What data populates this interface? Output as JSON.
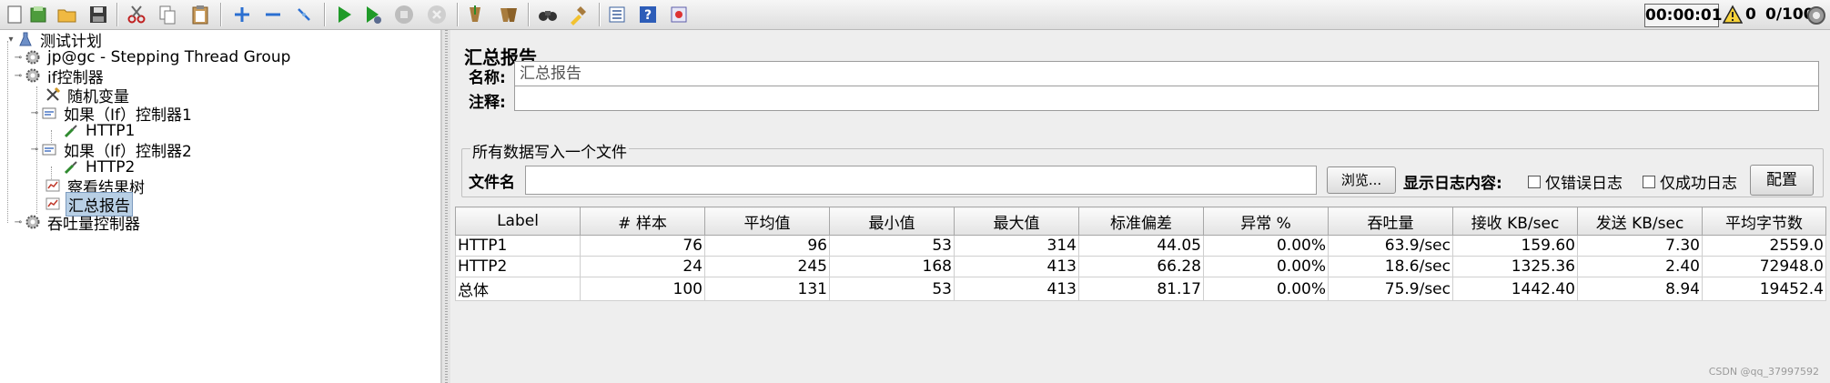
{
  "toolbar": {
    "buttons": [
      "new-icon",
      "templates-icon",
      "open-icon",
      "save-icon",
      "cut-icon",
      "copy-icon",
      "paste-icon",
      "expand-icon",
      "collapse-icon",
      "toggle-icon",
      "start-icon",
      "start-no-pause-icon",
      "stop-icon",
      "shutdown-icon",
      "clear-icon",
      "clear-all-icon",
      "search-icon",
      "reset-search-icon",
      "function-helper-icon",
      "help-icon",
      "remote-icon"
    ],
    "timer": "00:00:01",
    "error_count": "0",
    "threads": "0/100"
  },
  "tree": {
    "nodes": [
      {
        "label": "测试计划",
        "icon": "flask-icon"
      },
      {
        "label": "jp@gc - Stepping Thread Group",
        "icon": "gear-icon"
      },
      {
        "label": "if控制器",
        "icon": "gear-icon"
      },
      {
        "label": "随机变量",
        "icon": "tools-icon"
      },
      {
        "label": "如果（If）控制器1",
        "icon": "if-controller-icon"
      },
      {
        "label": "HTTP1",
        "icon": "pipette-icon"
      },
      {
        "label": "如果（If）控制器2",
        "icon": "if-controller-icon"
      },
      {
        "label": "HTTP2",
        "icon": "pipette-icon"
      },
      {
        "label": "察看结果树",
        "icon": "chart-icon"
      },
      {
        "label": "汇总报告",
        "icon": "chart-icon"
      },
      {
        "label": "吞吐量控制器",
        "icon": "gear-icon"
      }
    ]
  },
  "panel": {
    "title": "汇总报告",
    "name_label": "名称:",
    "name_value": "汇总报告",
    "comment_label": "注释:",
    "comment_value": "",
    "file_group_title": "所有数据写入一个文件",
    "filename_label": "文件名",
    "filename_value": "",
    "browse_button": "浏览...",
    "log_label": "显示日志内容:",
    "errors_only": "仅错误日志",
    "success_only": "仅成功日志",
    "config_button": "配置"
  },
  "table": {
    "headers": [
      "Label",
      "# 样本",
      "平均值",
      "最小值",
      "最大值",
      "标准偏差",
      "异常 %",
      "吞吐量",
      "接收 KB/sec",
      "发送 KB/sec",
      "平均字节数"
    ],
    "rows": [
      [
        "HTTP1",
        "76",
        "96",
        "53",
        "314",
        "44.05",
        "0.00%",
        "63.9/sec",
        "159.60",
        "7.30",
        "2559.0"
      ],
      [
        "HTTP2",
        "24",
        "245",
        "168",
        "413",
        "66.28",
        "0.00%",
        "18.6/sec",
        "1325.36",
        "2.40",
        "72948.0"
      ],
      [
        "总体",
        "100",
        "131",
        "53",
        "413",
        "81.17",
        "0.00%",
        "75.9/sec",
        "1442.40",
        "8.94",
        "19452.4"
      ]
    ]
  },
  "watermark": "CSDN @qq_37997592"
}
